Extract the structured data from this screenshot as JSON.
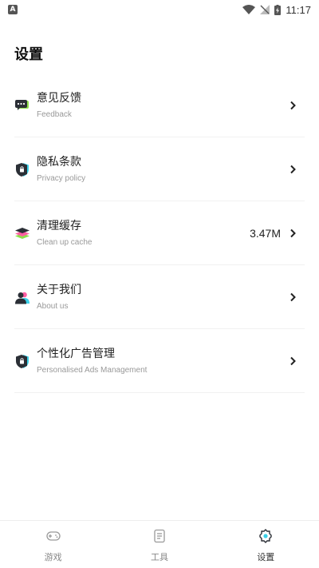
{
  "status_bar": {
    "time": "11:17",
    "notification_icon": "app-notification-icon",
    "icons": [
      "wifi-icon",
      "no-signal-icon",
      "battery-charging-icon"
    ]
  },
  "page": {
    "title": "设置"
  },
  "settings": [
    {
      "title": "意见反馈",
      "subtitle": "Feedback",
      "icon": "feedback-icon",
      "value": ""
    },
    {
      "title": "隐私条款",
      "subtitle": "Privacy policy",
      "icon": "privacy-shield-icon",
      "value": ""
    },
    {
      "title": "清理缓存",
      "subtitle": "Clean up cache",
      "icon": "layers-cache-icon",
      "value": "3.47M"
    },
    {
      "title": "关于我们",
      "subtitle": "About us",
      "icon": "people-icon",
      "value": ""
    },
    {
      "title": "个性化广告管理",
      "subtitle": "Personalised Ads Management",
      "icon": "ads-shield-icon",
      "value": ""
    }
  ],
  "bottom_nav": {
    "items": [
      {
        "label": "游戏",
        "icon": "gamepad-icon",
        "active": false
      },
      {
        "label": "工具",
        "icon": "document-icon",
        "active": false
      },
      {
        "label": "设置",
        "icon": "settings-gear-icon",
        "active": true
      }
    ]
  },
  "colors": {
    "accent_cyan": "#3ad0e8",
    "accent_green": "#8ee04b",
    "accent_pink": "#ff5fa2",
    "icon_dark": "#2b2f36",
    "divider": "#f1f1f1"
  }
}
